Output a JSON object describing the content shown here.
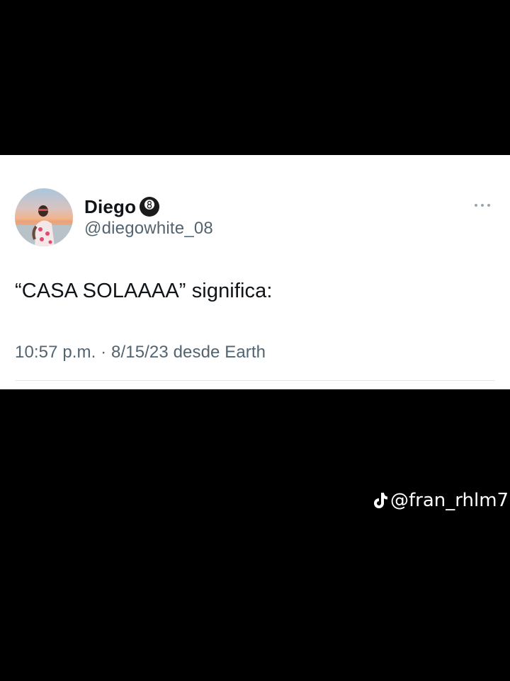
{
  "tweet": {
    "display_name": "Diego",
    "name_emoji_icon": "eight-ball-icon",
    "handle": "@diegowhite_08",
    "more_icon": "more-options-icon",
    "text": "“CASA SOLAAAA” significa:",
    "meta": "10:57 p.m. · 8/15/23 desde Earth"
  },
  "watermark": {
    "icon": "tiktok-icon",
    "text": "@fran_rhlm7"
  },
  "colors": {
    "background": "#000000",
    "card": "#ffffff",
    "primary_text": "#0f1419",
    "secondary_text": "#536471"
  }
}
